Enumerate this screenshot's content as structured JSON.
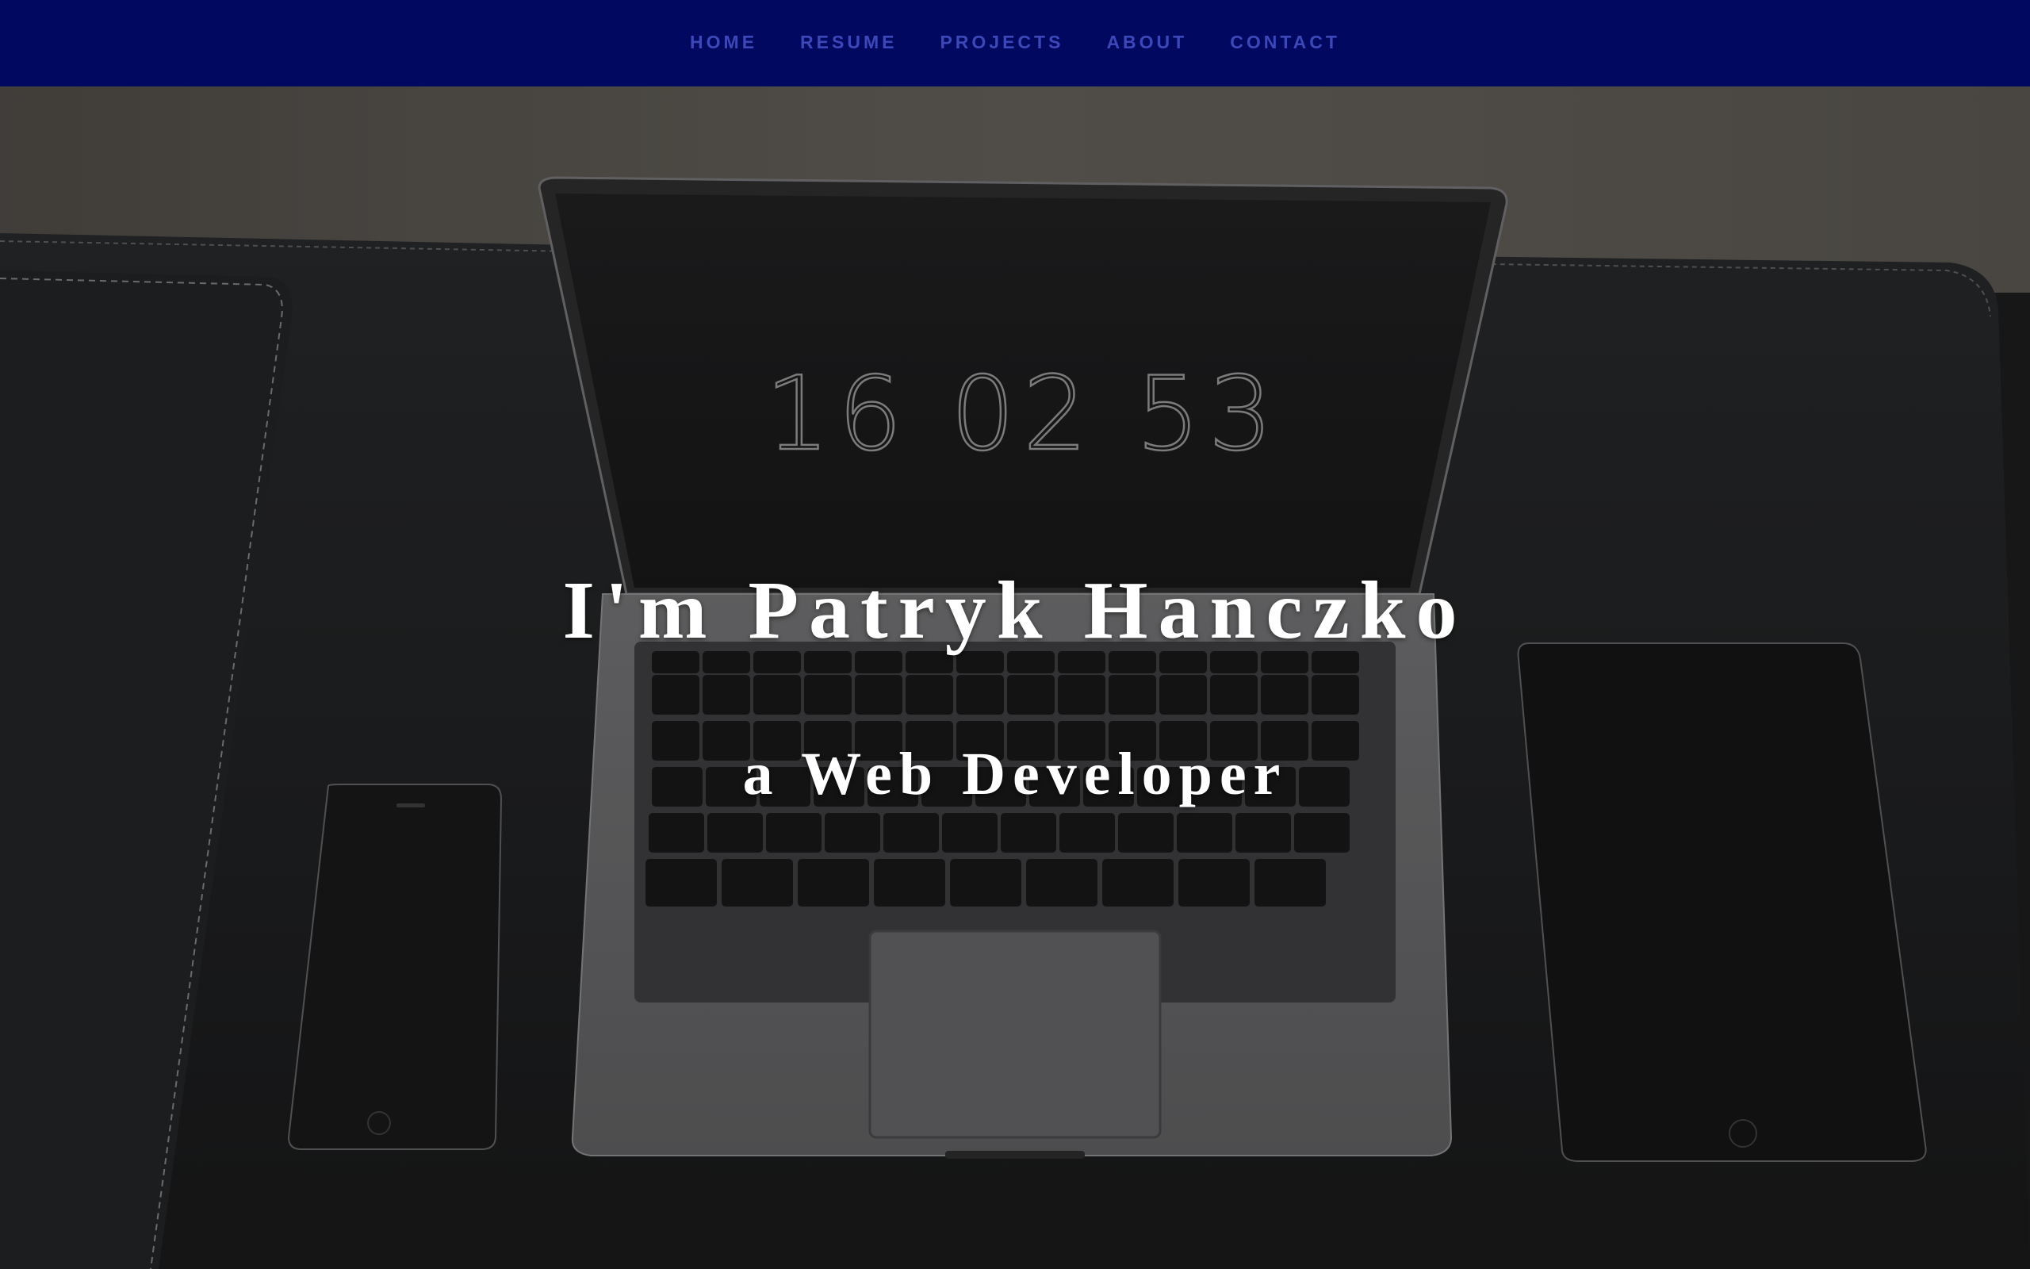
{
  "nav": {
    "items": [
      {
        "label": "HOME"
      },
      {
        "label": "RESUME"
      },
      {
        "label": "PROJECTS"
      },
      {
        "label": "ABOUT"
      },
      {
        "label": "CONTACT"
      }
    ]
  },
  "hero": {
    "headline": "I'm Patryk Hanczko",
    "subline": "a Web Developer",
    "background": {
      "laptop_clock": "16 02 53"
    }
  },
  "colors": {
    "nav_background": "#000860",
    "nav_link": "#3d48b8",
    "hero_text": "#ffffff"
  }
}
